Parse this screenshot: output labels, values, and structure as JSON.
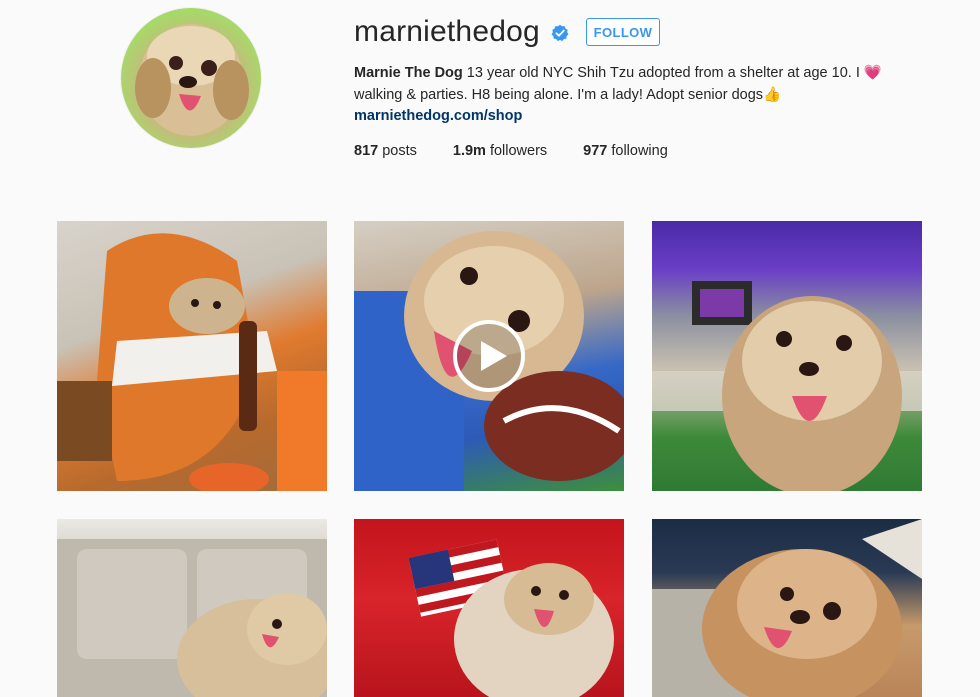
{
  "profile": {
    "username": "marniethedog",
    "verified_icon": "verified-badge-icon",
    "follow_label": "FOLLOW",
    "accent_color": "#3897f0",
    "bio_name": "Marnie The Dog",
    "bio_line1": "13 year old NYC Shih Tzu adopted from a shelter at age 10. I ",
    "bio_emoji_heart": "💗",
    "bio_line2": "walking & parties. H8 being alone. I'm a lady! Adopt senior dogs",
    "bio_emoji_thumb": "👍",
    "link": "marniethedog.com/shop",
    "stats": [
      {
        "value": "817",
        "label": "posts"
      },
      {
        "value": "1.9m",
        "label": "followers"
      },
      {
        "value": "977",
        "label": "following"
      }
    ]
  },
  "posts": [
    {
      "name": "post-dog-football-fan-costume",
      "icon": "photo"
    },
    {
      "name": "post-dog-football-jersey-video",
      "icon": "play-icon"
    },
    {
      "name": "post-dog-stadium-selfie",
      "icon": "photo"
    },
    {
      "name": "post-dog-on-couch",
      "icon": "photo"
    },
    {
      "name": "post-dog-american-flag",
      "icon": "photo"
    },
    {
      "name": "post-dog-blanket-tongue",
      "icon": "photo"
    }
  ]
}
